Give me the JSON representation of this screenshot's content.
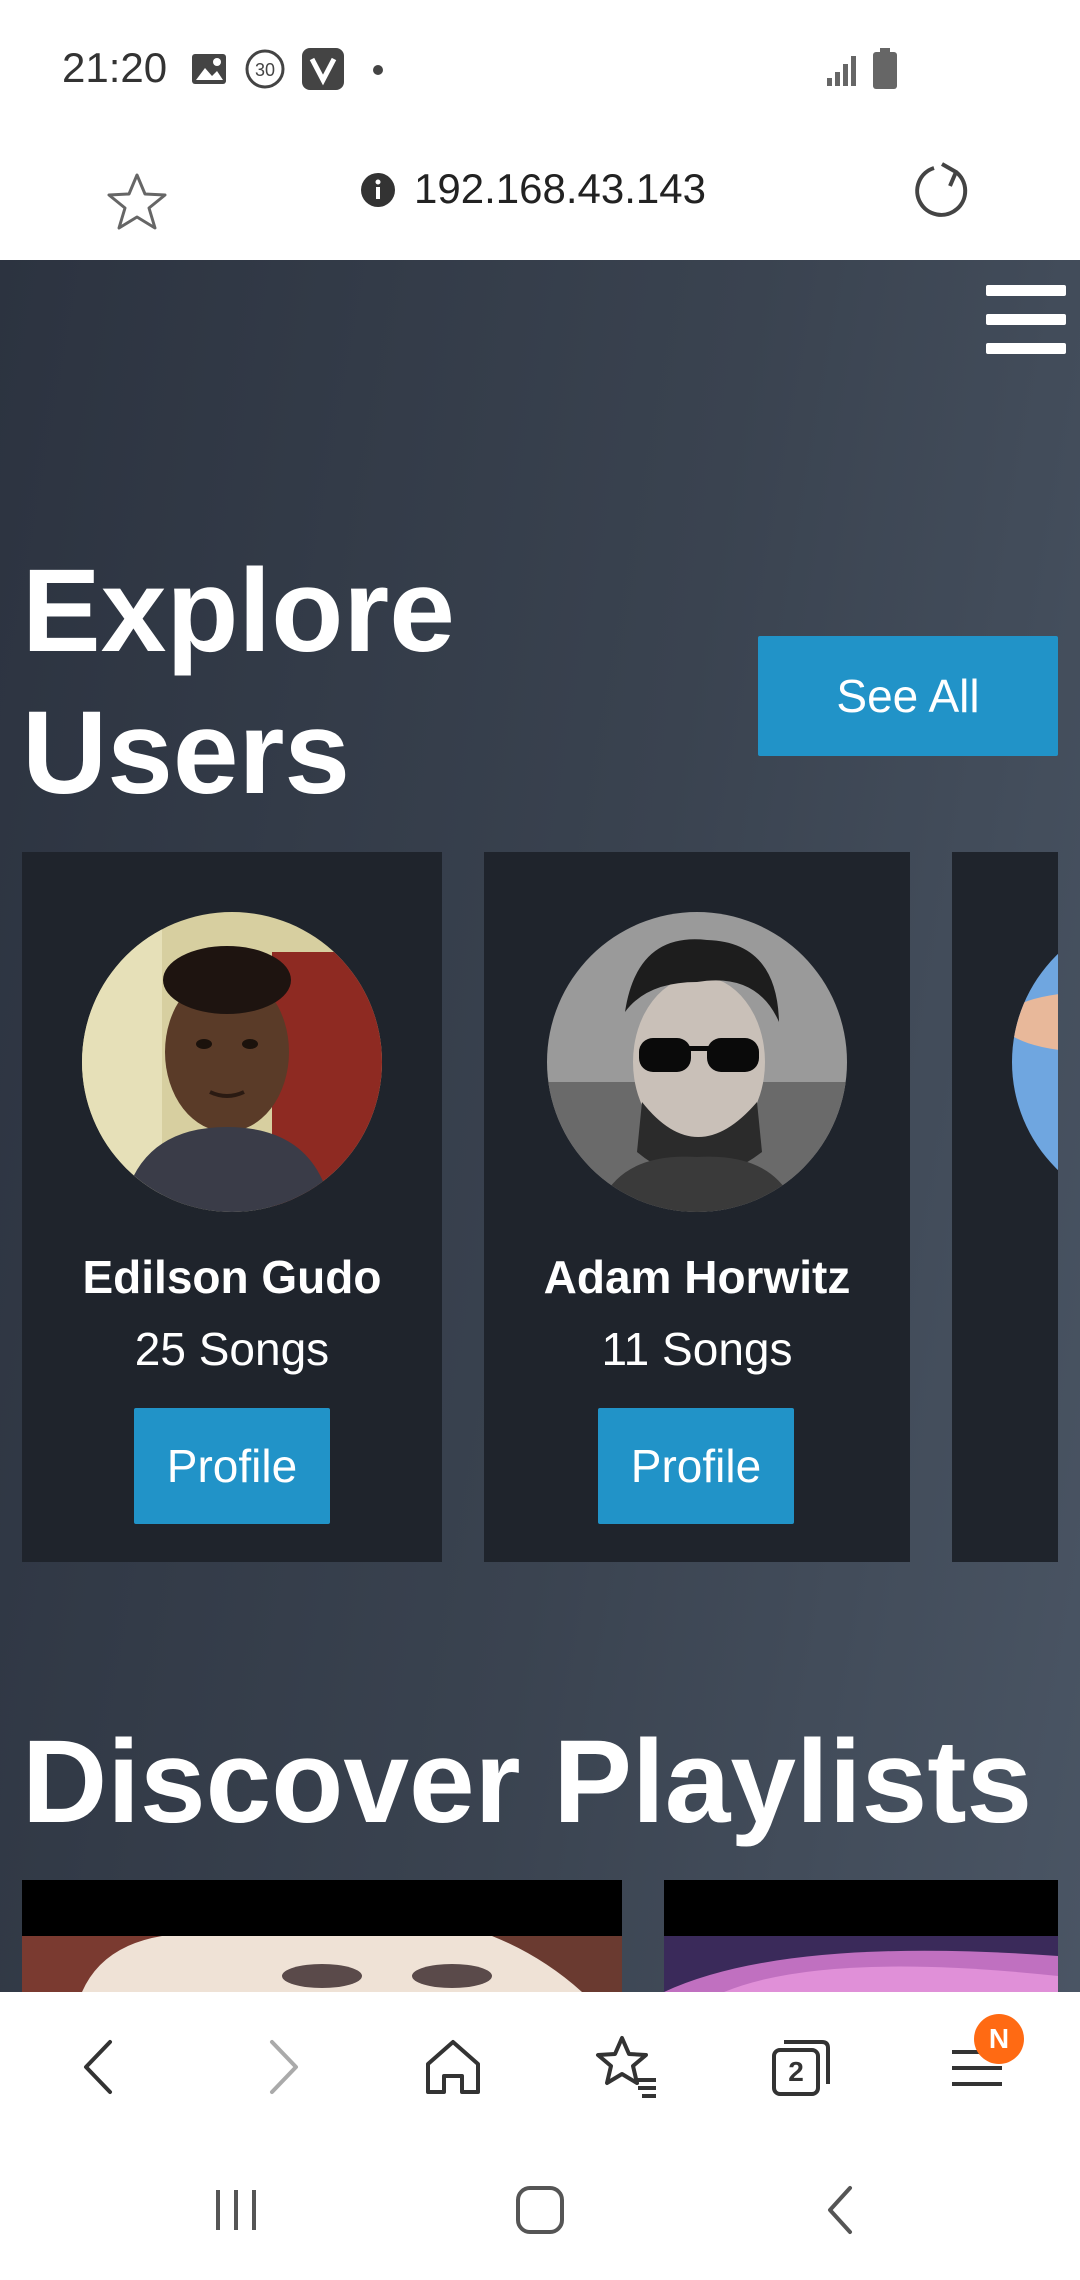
{
  "status_bar": {
    "time": "21:20",
    "notification_icons": [
      "image-icon",
      "thirty-badge-icon",
      "vivo-v-icon",
      "dot-icon"
    ],
    "system_icons": [
      "signal-icon",
      "battery-icon"
    ]
  },
  "url_bar": {
    "url": "192.168.43.143",
    "left_icon": "star-outline-icon",
    "info_icon": "info-icon",
    "right_icon": "reload-icon"
  },
  "page": {
    "menu_icon": "hamburger-menu-icon",
    "explore_title": "Explore Users",
    "see_all_label": "See All",
    "users": [
      {
        "name": "Edilson Gudo",
        "songs": "25 Songs",
        "button": "Profile"
      },
      {
        "name": "Adam Horwitz",
        "songs": "11 Songs",
        "button": "Profile"
      }
    ],
    "discover_title": "Discover Playlists"
  },
  "browser_nav": {
    "icons": [
      "back-icon",
      "forward-icon",
      "home-icon",
      "bookmarks-icon",
      "tabs-icon",
      "menu-icon"
    ],
    "tabs_count": "2",
    "menu_badge": "N"
  },
  "system_nav": {
    "icons": [
      "recents-icon",
      "home-button-icon",
      "back-button-icon"
    ]
  },
  "colors": {
    "accent": "#2193c8",
    "card_bg": "#1f242c",
    "badge": "#ff6a13"
  }
}
